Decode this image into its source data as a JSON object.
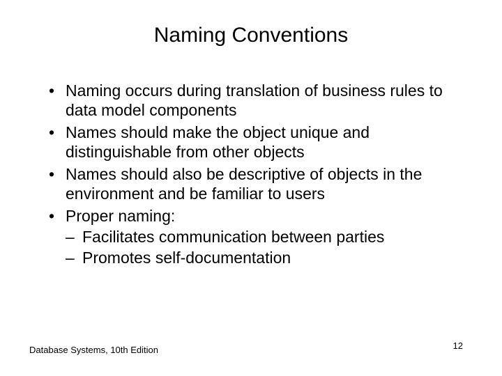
{
  "title": "Naming Conventions",
  "bullets": [
    {
      "text": "Naming occurs during translation of business rules to data model components"
    },
    {
      "text": "Names should make the object unique and distinguishable from other objects"
    },
    {
      "text": "Names should also be descriptive of objects in the environment and be familiar to users"
    },
    {
      "text": "Proper naming:",
      "sub": [
        "Facilitates communication between parties",
        "Promotes self-documentation"
      ]
    }
  ],
  "footer": {
    "left": "Database Systems, 10th Edition",
    "page": "12"
  }
}
